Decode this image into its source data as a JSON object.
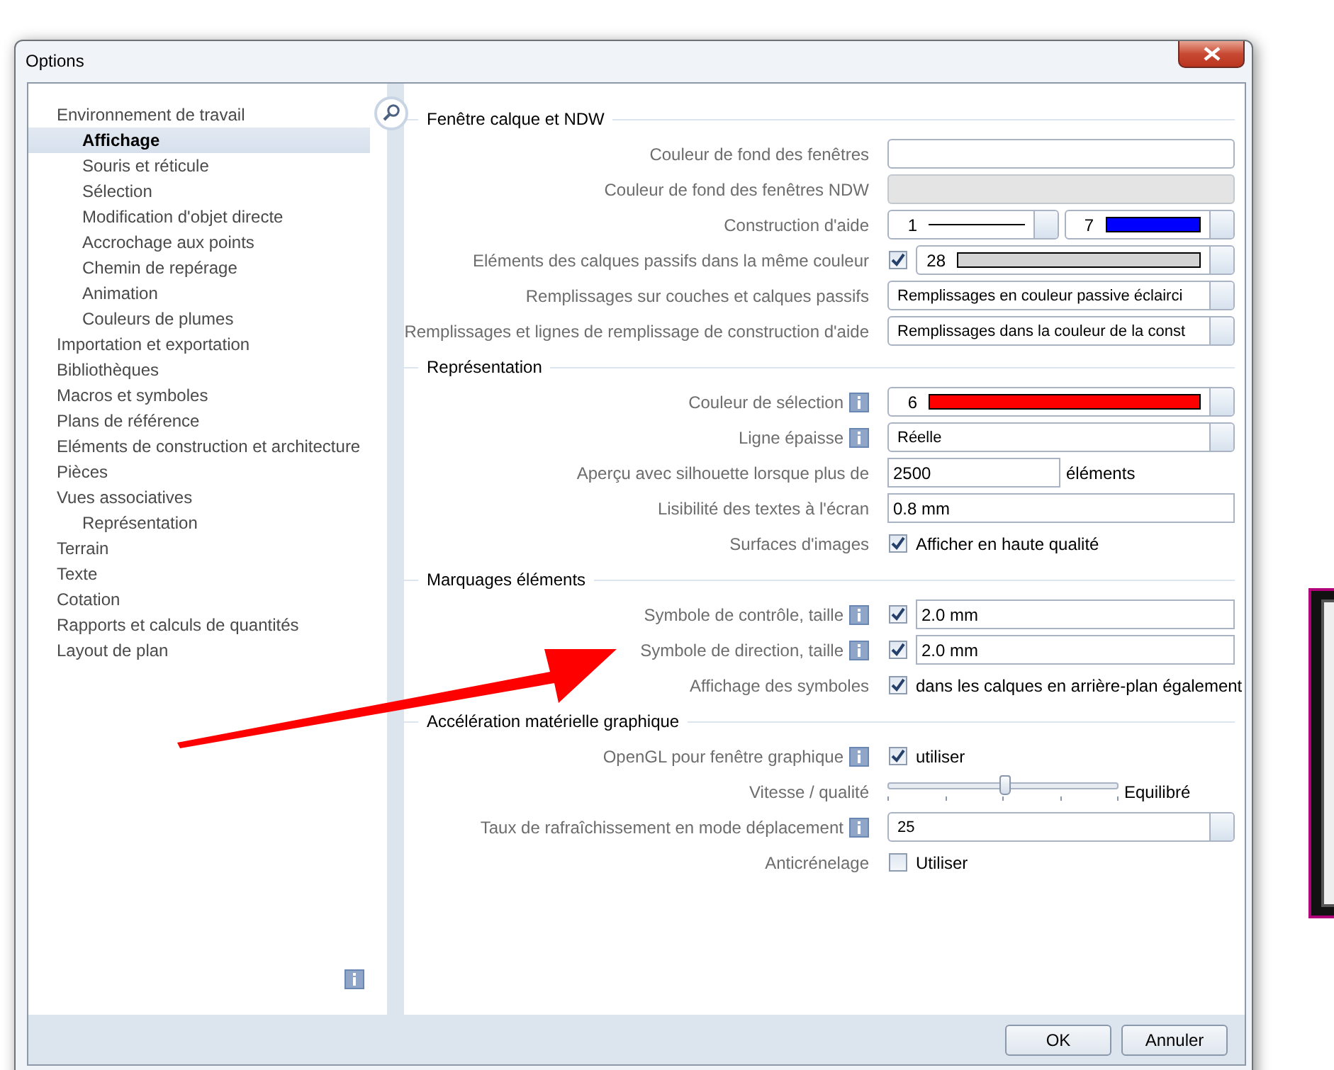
{
  "window": {
    "title": "Options"
  },
  "sidebar": {
    "items": [
      {
        "label": "Environnement de travail",
        "selected": false,
        "children": [
          {
            "label": "Affichage",
            "selected": true
          },
          {
            "label": "Souris et réticule",
            "selected": false
          },
          {
            "label": "Sélection",
            "selected": false
          },
          {
            "label": "Modification d'objet directe",
            "selected": false
          },
          {
            "label": "Accrochage aux points",
            "selected": false
          },
          {
            "label": "Chemin de repérage",
            "selected": false
          },
          {
            "label": "Animation",
            "selected": false
          },
          {
            "label": "Couleurs de plumes",
            "selected": false
          }
        ]
      },
      {
        "label": "Importation et exportation",
        "selected": false
      },
      {
        "label": "Bibliothèques",
        "selected": false
      },
      {
        "label": "Macros et symboles",
        "selected": false
      },
      {
        "label": "Plans de référence",
        "selected": false
      },
      {
        "label": "Eléments de construction et architecture",
        "selected": false
      },
      {
        "label": "Pièces",
        "selected": false
      },
      {
        "label": "Vues associatives",
        "selected": false,
        "children": [
          {
            "label": "Représentation",
            "selected": false
          }
        ]
      },
      {
        "label": "Terrain",
        "selected": false
      },
      {
        "label": "Texte",
        "selected": false
      },
      {
        "label": "Cotation",
        "selected": false
      },
      {
        "label": "Rapports et calculs de quantités",
        "selected": false
      },
      {
        "label": "Layout de plan",
        "selected": false
      }
    ]
  },
  "sections": [
    {
      "title": "Fenêtre calque et NDW",
      "rows": [
        {
          "kind": "color_field",
          "label": "Couleur de fond des fenêtres",
          "info": false,
          "disabled": false
        },
        {
          "kind": "color_field",
          "label": "Couleur de fond des fenêtres NDW",
          "info": false,
          "disabled": true
        },
        {
          "kind": "pen_pair",
          "label": "Construction d'aide",
          "info": false,
          "line": "1",
          "number": "7",
          "color": "#0000ff"
        },
        {
          "kind": "check_swatch",
          "label": "Eléments des calques passifs dans la même couleur",
          "info": false,
          "checked": true,
          "number": "28",
          "color": "#d4d4d4"
        },
        {
          "kind": "combo",
          "label": "Remplissages sur couches et calques passifs",
          "info": false,
          "value": "Remplissages en couleur passive éclairci"
        },
        {
          "kind": "combo",
          "label": "Remplissages et lignes de remplissage de construction d'aide",
          "info": false,
          "value": "Remplissages dans la couleur de la const"
        }
      ]
    },
    {
      "title": "Représentation",
      "rows": [
        {
          "kind": "swatch_combo",
          "label": "Couleur de sélection",
          "info": true,
          "number": "6",
          "color": "#ff0000"
        },
        {
          "kind": "combo",
          "label": "Ligne épaisse",
          "info": true,
          "value": "Réelle"
        },
        {
          "kind": "input",
          "label": "Aperçu avec silhouette lorsque plus de",
          "info": false,
          "value": "2500",
          "unit": "éléments"
        },
        {
          "kind": "input",
          "label": "Lisibilité des textes à l'écran",
          "info": false,
          "value": "0.8 mm"
        },
        {
          "kind": "checkbox",
          "label": "Surfaces d'images",
          "info": false,
          "checked": true,
          "text": "Afficher en haute qualité"
        }
      ]
    },
    {
      "title": "Marquages éléments",
      "rows": [
        {
          "kind": "check_input",
          "label": "Symbole de contrôle, taille",
          "info": true,
          "checked": true,
          "value": "2.0 mm"
        },
        {
          "kind": "check_input",
          "label": "Symbole de direction, taille",
          "info": true,
          "checked": true,
          "value": "2.0 mm"
        },
        {
          "kind": "checkbox",
          "label": "Affichage des symboles",
          "info": false,
          "checked": true,
          "text": "dans les calques en arrière-plan également"
        }
      ]
    },
    {
      "title": "Accélération matérielle graphique",
      "rows": [
        {
          "kind": "checkbox",
          "label": "OpenGL pour fenêtre graphique",
          "info": true,
          "checked": true,
          "text": "utiliser"
        },
        {
          "kind": "slider",
          "label": "Vitesse / qualité",
          "info": false,
          "level": 0.5,
          "reading": "Equilibré"
        },
        {
          "kind": "combo",
          "label": "Taux de rafraîchissement en mode déplacement",
          "info": true,
          "value": "25"
        },
        {
          "kind": "checkbox",
          "label": "Anticrénelage",
          "info": false,
          "checked": false,
          "text": "Utiliser"
        }
      ]
    }
  ],
  "buttons": [
    "OK",
    "Annuler"
  ]
}
